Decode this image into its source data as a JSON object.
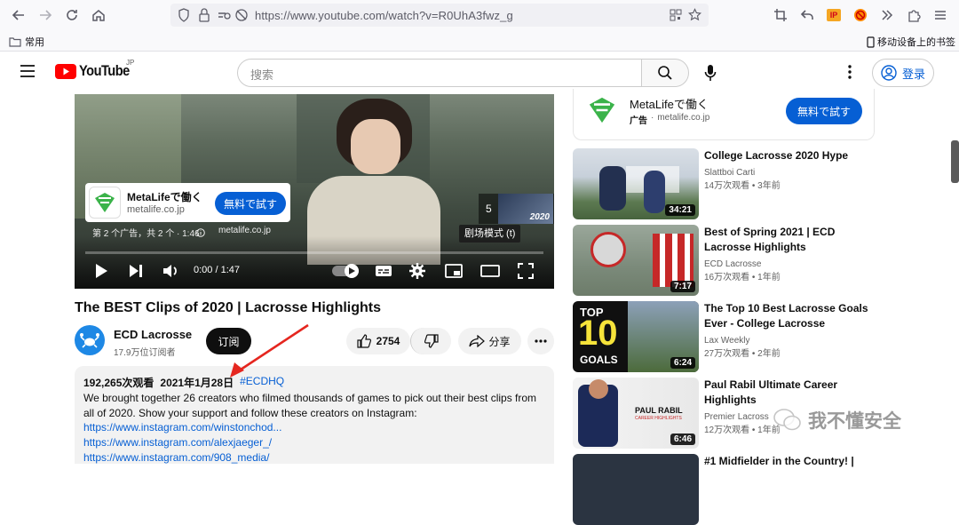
{
  "browser": {
    "url": "https://www.youtube.com/watch?v=R0UhA3fwz_g",
    "bookmark_folder": "常用",
    "mobile_bookmarks": "移动设备上的书签"
  },
  "header": {
    "logo_text": "YouTube",
    "logo_region": "JP",
    "search_placeholder": "搜索",
    "signin_label": "登录"
  },
  "player": {
    "ad_title": "MetaLifeで働く",
    "ad_domain": "metalife.co.jp",
    "ad_cta": "無料で試す",
    "ad_info": "第 2 个广告，共 2 个 · 1:46",
    "ad_link": "metalife.co.jp",
    "next_count": "5",
    "theater_tooltip": "剧场模式 (t)",
    "time": "0:00 / 1:47",
    "thumb_badge": "2020"
  },
  "video": {
    "title": "The BEST Clips of 2020 | Lacrosse Highlights",
    "channel": "ECD Lacrosse",
    "subscribers": "17.9万位订阅者",
    "subscribe_label": "订阅",
    "likes": "2754",
    "share_label": "分享"
  },
  "description": {
    "views": "192,265次观看",
    "date": "2021年1月28日",
    "hashtag": "#ECDHQ",
    "body": "We brought together 26 creators who filmed thousands of games to pick out their best clips from all of 2020. Show your support and follow these creators on Instagram:",
    "links": [
      "https://www.instagram.com/winstonchod...",
      "https://www.instagram.com/alexjaeger_/",
      "https://www.instagram.com/908_media/"
    ]
  },
  "sidebar_ad": {
    "title": "MetaLifeで働く",
    "label": "广告",
    "domain": "metalife.co.jp",
    "cta": "無料で試す"
  },
  "recommendations": [
    {
      "title": "College Lacrosse 2020 Hype",
      "channel": "Slattboi Carti",
      "meta": "14万次观看 • 3年前",
      "duration": "34:21"
    },
    {
      "title": "Best of Spring 2021 | ECD Lacrosse Highlights",
      "channel": "ECD Lacrosse",
      "meta": "16万次观看 • 1年前",
      "duration": "7:17"
    },
    {
      "title": "The Top 10 Best Lacrosse Goals Ever - College Lacrosse",
      "channel": "Lax Weekly",
      "meta": "27万次观看 • 2年前",
      "duration": "6:24"
    },
    {
      "title": "Paul Rabil Ultimate Career Highlights",
      "channel": "Premier Lacross",
      "meta": "12万次观看 • 1年前",
      "duration": "6:46"
    },
    {
      "title": "#1 Midfielder in the Country! |",
      "channel": "",
      "meta": "",
      "duration": ""
    }
  ],
  "thumb_text": {
    "top10_a": "TOP",
    "top10_b": "10",
    "top10_c": "GOALS",
    "rabil_a": "PAUL RABIL",
    "rabil_b": "CAREER HIGHLIGHTS"
  },
  "watermark": "我不懂安全"
}
